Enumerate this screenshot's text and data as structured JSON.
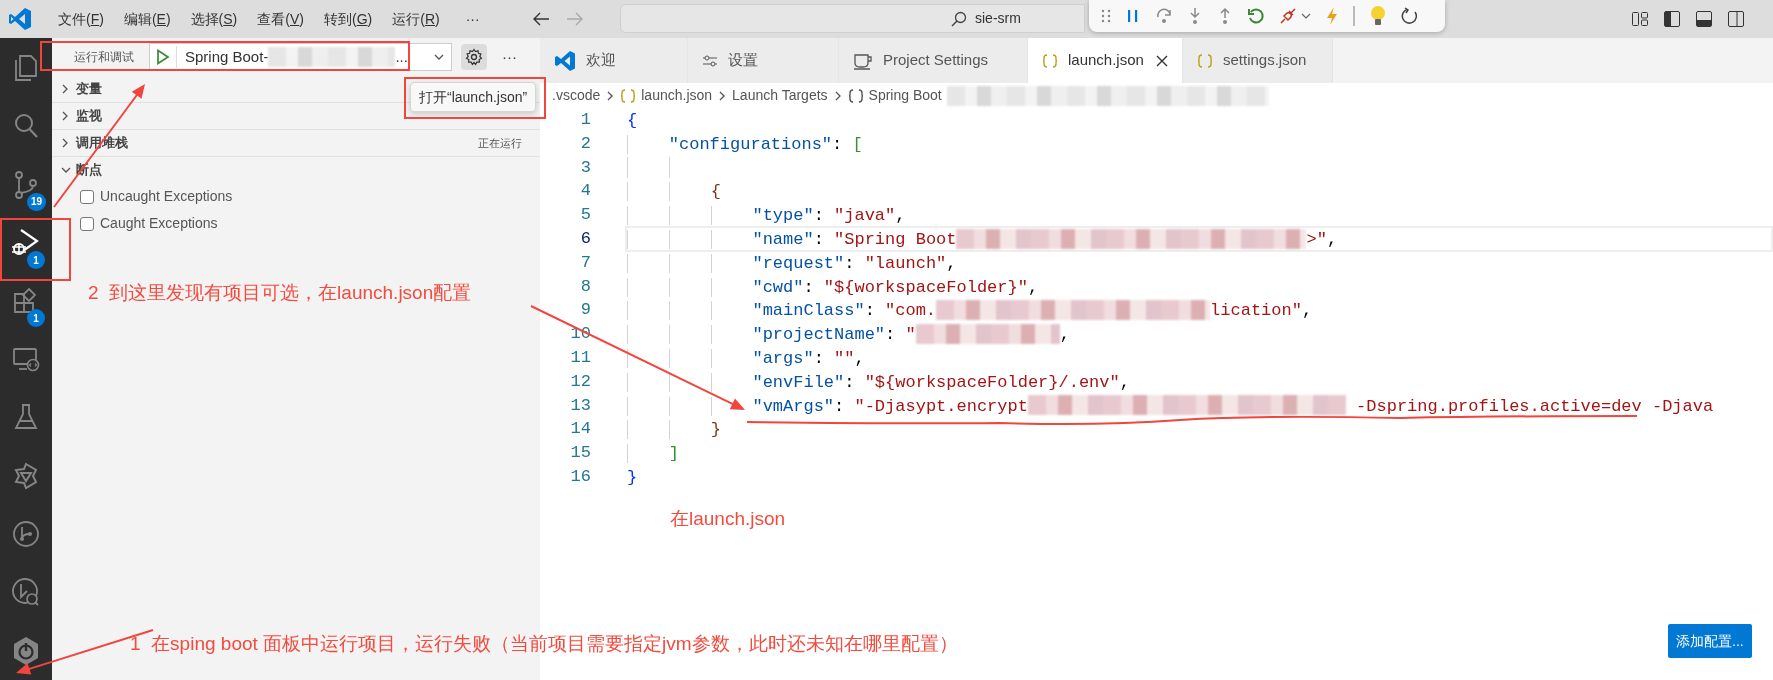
{
  "title_bar": {
    "menu": [
      "文件(F)",
      "编辑(E)",
      "选择(S)",
      "查看(V)",
      "转到(G)",
      "运行(R)"
    ],
    "more": "···",
    "search": "sie-srm"
  },
  "activity_bar": [
    {
      "kind": "files",
      "selected": false
    },
    {
      "kind": "search",
      "selected": false
    },
    {
      "kind": "source-control",
      "badge": "19",
      "selected": false
    },
    {
      "kind": "run-debug",
      "badge": "1",
      "selected": true
    },
    {
      "kind": "extensions",
      "badge": "1",
      "selected": false
    },
    {
      "kind": "remote",
      "selected": false
    },
    {
      "kind": "testing",
      "selected": false
    },
    {
      "kind": "hexagon",
      "selected": false
    },
    {
      "kind": "git-graph",
      "selected": false
    },
    {
      "kind": "git-search",
      "selected": false
    },
    {
      "kind": "power",
      "selected": false
    }
  ],
  "sidebar": {
    "title": "运行和调试",
    "config": [
      {
        "kind": "text",
        "text": "Spring Boot-"
      },
      {
        "kind": "redacted"
      },
      {
        "kind": "text",
        "text": "..."
      }
    ],
    "more": "···",
    "tooltip": "打开“launch.json”",
    "sections": [
      {
        "label": "变量",
        "expanded": false
      },
      {
        "label": "监视",
        "expanded": false
      },
      {
        "label": "调用堆栈",
        "expanded": false,
        "status": "正在运行"
      },
      {
        "label": "断点",
        "expanded": true,
        "items": [
          {
            "label": "Uncaught Exceptions",
            "checked": false
          },
          {
            "label": "Caught Exceptions",
            "checked": false
          }
        ]
      }
    ]
  },
  "editor": {
    "tabs": [
      {
        "label": "欢迎",
        "kind": "welcome",
        "selected": false
      },
      {
        "label": "设置",
        "kind": "settings",
        "selected": false
      },
      {
        "label": "Project Settings",
        "kind": "project",
        "selected": false
      },
      {
        "label": "launch.json",
        "kind": "json",
        "selected": true
      },
      {
        "label": "settings.json",
        "kind": "json",
        "selected": false
      }
    ],
    "breadcrumb": [
      {
        "kind": "folder",
        "parts": [
          {
            "kind": "text",
            "text": ".vscode"
          }
        ]
      },
      {
        "kind": "json",
        "parts": [
          {
            "kind": "text",
            "text": "launch.json"
          }
        ]
      },
      {
        "kind": "folder",
        "parts": [
          {
            "kind": "text",
            "text": "Launch Targets"
          }
        ]
      },
      {
        "kind": "object",
        "parts": [
          {
            "kind": "text",
            "text": "Spring Boot"
          },
          {
            "kind": "redacted"
          }
        ]
      }
    ],
    "lines": [
      {
        "number": "1",
        "current": false,
        "tokens": [
          {
            "kind": "brace1",
            "text": "{"
          }
        ]
      },
      {
        "number": "2",
        "current": false,
        "tokens": [
          {
            "kind": "key",
            "text": "    \"configurations\""
          },
          {
            "kind": "punct",
            "text": ": "
          },
          {
            "kind": "brace2",
            "text": "["
          }
        ]
      },
      {
        "number": "3",
        "current": false
      },
      {
        "number": "4",
        "current": false,
        "tokens": [
          {
            "kind": "brace3",
            "text": "        {"
          }
        ]
      },
      {
        "number": "5",
        "current": false,
        "tokens": [
          {
            "kind": "key",
            "text": "            \"type\""
          },
          {
            "kind": "punct",
            "text": ": "
          },
          {
            "kind": "string",
            "text": "\"java\""
          },
          {
            "kind": "punct",
            "text": ","
          }
        ]
      },
      {
        "number": "6",
        "current": true,
        "tokens": [
          {
            "kind": "key",
            "text": "            \"name\""
          },
          {
            "kind": "punct",
            "text": ": "
          },
          {
            "kind": "string",
            "text": "\"Spring Boot"
          },
          {
            "kind": "redacted"
          },
          {
            "kind": "string",
            "text": ">\""
          },
          {
            "kind": "punct",
            "text": ","
          }
        ]
      },
      {
        "number": "7",
        "current": false,
        "tokens": [
          {
            "kind": "key",
            "text": "            \"request\""
          },
          {
            "kind": "punct",
            "text": ": "
          },
          {
            "kind": "string",
            "text": "\"launch\""
          },
          {
            "kind": "punct",
            "text": ","
          }
        ]
      },
      {
        "number": "8",
        "current": false,
        "tokens": [
          {
            "kind": "key",
            "text": "            \"cwd\""
          },
          {
            "kind": "punct",
            "text": ": "
          },
          {
            "kind": "string",
            "text": "\"${workspaceFolder}\""
          },
          {
            "kind": "punct",
            "text": ","
          }
        ]
      },
      {
        "number": "9",
        "current": false,
        "tokens": [
          {
            "kind": "key",
            "text": "            \"mainClass\""
          },
          {
            "kind": "punct",
            "text": ": "
          },
          {
            "kind": "string",
            "text": "\"com."
          },
          {
            "kind": "redacted"
          },
          {
            "kind": "string",
            "text": "lication\""
          },
          {
            "kind": "punct",
            "text": ","
          }
        ]
      },
      {
        "number": "10",
        "current": false,
        "tokens": [
          {
            "kind": "key",
            "text": "            \"projectName\""
          },
          {
            "kind": "punct",
            "text": ": "
          },
          {
            "kind": "string",
            "text": "\""
          },
          {
            "kind": "redacted"
          },
          {
            "kind": "punct",
            "text": ","
          }
        ]
      },
      {
        "number": "11",
        "current": false,
        "tokens": [
          {
            "kind": "key",
            "text": "            \"args\""
          },
          {
            "kind": "punct",
            "text": ": "
          },
          {
            "kind": "string",
            "text": "\"\""
          },
          {
            "kind": "punct",
            "text": ","
          }
        ]
      },
      {
        "number": "12",
        "current": false,
        "tokens": [
          {
            "kind": "key",
            "text": "            \"envFile\""
          },
          {
            "kind": "punct",
            "text": ": "
          },
          {
            "kind": "string",
            "text": "\"${workspaceFolder}/.env\""
          },
          {
            "kind": "punct",
            "text": ","
          }
        ]
      },
      {
        "number": "13",
        "current": false,
        "tokens": [
          {
            "kind": "key",
            "text": "            \"vmArgs\""
          },
          {
            "kind": "punct",
            "text": ": "
          },
          {
            "kind": "string",
            "text": "\"-Djasypt.encrypt"
          },
          {
            "kind": "redacted"
          },
          {
            "kind": "string",
            "text": " -Dspring.profiles.active=dev -Djava"
          }
        ]
      },
      {
        "number": "14",
        "current": false,
        "tokens": [
          {
            "kind": "brace3",
            "text": "        }"
          }
        ]
      },
      {
        "number": "15",
        "current": false,
        "tokens": [
          {
            "kind": "brace2",
            "text": "    ]"
          }
        ]
      },
      {
        "number": "16",
        "current": false,
        "tokens": [
          {
            "kind": "brace1",
            "text": "}"
          }
        ]
      }
    ],
    "add_button": "添加配置..."
  },
  "annotations": [
    "2  到这里发现有项目可选，在launch.json配置",
    "在launch.json",
    "1  在sping boot 面板中运行项目，运行失败（当前项目需要指定jvm参数，此时还未知在哪里配置）"
  ]
}
